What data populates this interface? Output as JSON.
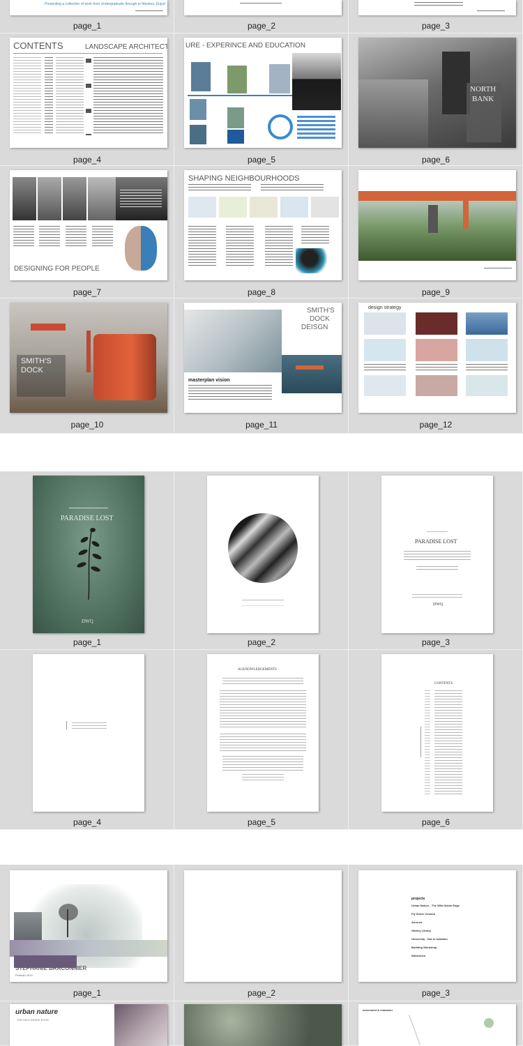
{
  "portfolio1": {
    "page1_strip_text": "Presenting a collection of work from Undergraduate through to Masters. Enjoy!",
    "page4": {
      "contents": "CONTENTS",
      "heading": "LANDSCAPE ARCHITECT"
    },
    "page5": {
      "heading": "URE - EXPERINCE AND EDUCATION"
    },
    "page6": {
      "title_line1": "NORTH",
      "title_line2": "BANK"
    },
    "page7": {
      "heading": "DESIGNING FOR PEOPLE"
    },
    "page8": {
      "heading": "SHAPING NEIGHBOURHOODS"
    },
    "page10": {
      "title_line1": "SMITH'S",
      "title_line2": "DOCK"
    },
    "page11": {
      "title_line1": "SMITH'S",
      "title_line2": "DOCK",
      "title_line3": "DEISGN",
      "caption": "masterplan vision"
    },
    "page12": {
      "heading": "design strategy"
    },
    "captions": [
      "page_1",
      "page_2",
      "page_3",
      "page_4",
      "page_5",
      "page_6",
      "page_7",
      "page_8",
      "page_9",
      "page_10",
      "page_11",
      "page_12"
    ]
  },
  "portfolio2": {
    "cover_title": "PARADISE LOST",
    "cover_footer": "DWQ",
    "title_page_heading": "PARADISE LOST",
    "title_page_footer": "DWQ",
    "ack_heading": "ACKNOWLEDGEMENTS",
    "contents_heading": "CONTENTS",
    "captions": [
      "page_1",
      "page_2",
      "page_3",
      "page_4",
      "page_5",
      "page_6"
    ]
  },
  "portfolio3": {
    "cover_name": "STEPHANIE BRACONNIER",
    "cover_sub": "Portfolio 2020",
    "projects_heading": "projects",
    "projects": [
      "Urban Nature - The Wild Inside Edge",
      "Fly Shore Cinema",
      "Aurorea",
      "Gallery Library",
      "University - Not In Isolation",
      "Building Workshop",
      "Whitechen"
    ],
    "urban_title": "urban nature",
    "urban_sub": "THE WILD INSIDE EDGE",
    "page6_heading": "movement & character",
    "captions": [
      "page_1",
      "page_2",
      "page_3"
    ]
  },
  "colors": {
    "background": "#dadada",
    "divider": "#ffffff",
    "caption": "#222222",
    "accent_orange": "#e2633a"
  }
}
